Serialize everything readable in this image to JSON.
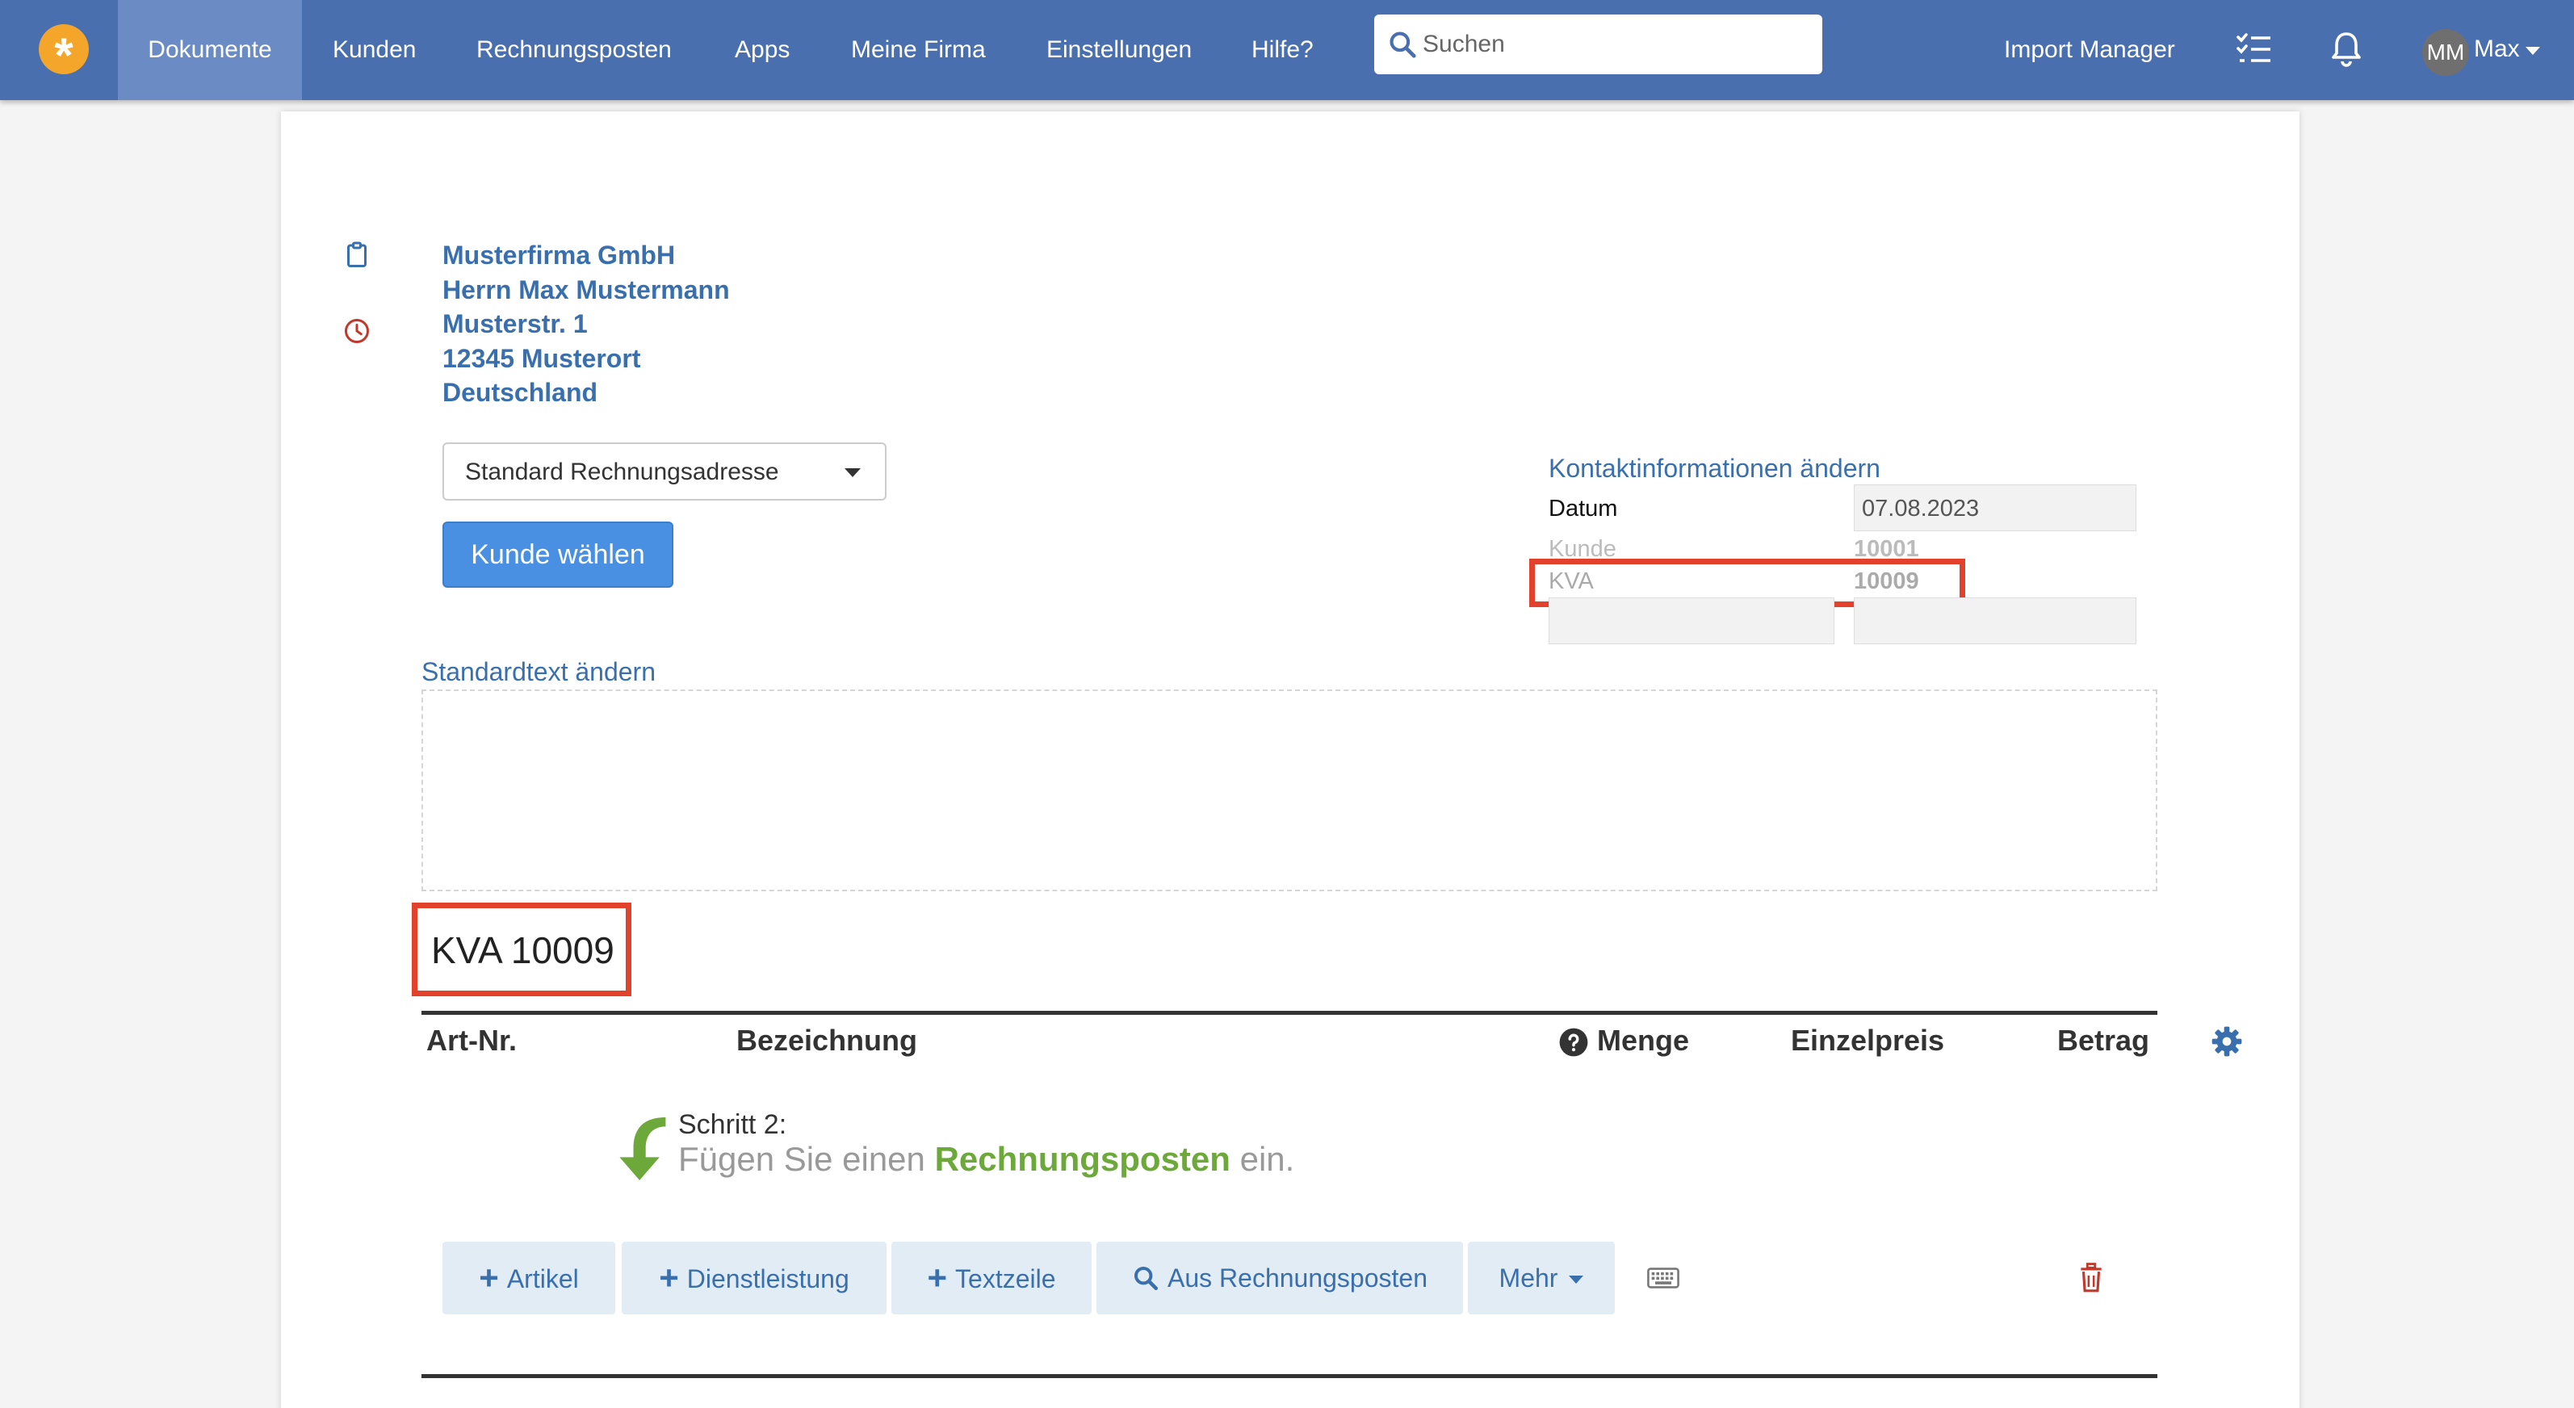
{
  "nav": {
    "items": [
      {
        "label": "Dokumente",
        "active": true
      },
      {
        "label": "Kunden"
      },
      {
        "label": "Rechnungsposten"
      },
      {
        "label": "Apps"
      },
      {
        "label": "Meine Firma"
      },
      {
        "label": "Einstellungen"
      },
      {
        "label": "Hilfe?"
      }
    ],
    "search_placeholder": "Suchen",
    "import_manager": "Import Manager",
    "avatar_initials": "MM",
    "user_name": "Max"
  },
  "customer": {
    "address_lines": [
      "Musterfirma GmbH",
      "Herrn Max Mustermann",
      "Musterstr. 1",
      "12345 Musterort",
      "Deutschland"
    ],
    "address_select": "Standard Rechnungsadresse",
    "choose_button": "Kunde wählen"
  },
  "contact": {
    "change_link": "Kontaktinformationen ändern",
    "date_label": "Datum",
    "date_value": "07.08.2023",
    "customer_label": "Kunde",
    "customer_value": "10001",
    "kva_label": "KVA",
    "kva_value": "10009"
  },
  "standard_text_link": "Standardtext ändern",
  "document_title": "KVA 10009",
  "table_headers": {
    "art_nr": "Art-Nr.",
    "bezeichnung": "Bezeichnung",
    "menge": "Menge",
    "einzelpreis": "Einzelpreis",
    "betrag": "Betrag"
  },
  "step": {
    "title": "Schritt 2:",
    "text_before": "Fügen Sie einen",
    "text_highlight": "Rechnungsposten",
    "text_after": "ein."
  },
  "actions": {
    "artikel": "Artikel",
    "dienstleistung": "Dienstleistung",
    "textzeile": "Textzeile",
    "aus_rechnungsposten": "Aus Rechnungsposten",
    "mehr": "Mehr"
  },
  "colors": {
    "navbar": "#4a6fae",
    "link": "#3a6fae",
    "primary": "#4a90e2",
    "highlight": "#e2412b",
    "step_green": "#6da83a"
  }
}
